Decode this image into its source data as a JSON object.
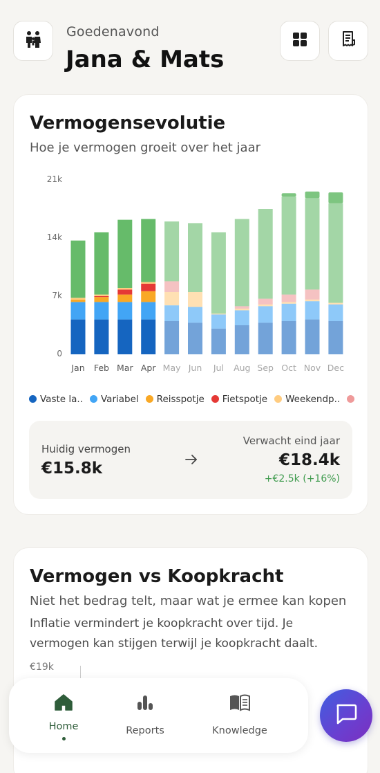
{
  "header": {
    "greeting": "Goedenavond",
    "names": "Jana & Mats",
    "family_icon": "family-icon",
    "grid_icon": "grid-icon",
    "receipt_icon": "receipt-icon"
  },
  "wealth_card": {
    "title": "Vermogensevolutie",
    "subtitle": "Hoe je vermogen groeit over het jaar",
    "legend": [
      {
        "label": "Vaste la..",
        "color": "#1565c0"
      },
      {
        "label": "Variabel",
        "color": "#42a5f5"
      },
      {
        "label": "Reisspotje",
        "color": "#f9a825"
      },
      {
        "label": "Fietspotje",
        "color": "#e53935"
      },
      {
        "label": "Weekendp..",
        "color": "#ffcc80"
      },
      {
        "label": "",
        "color": "#ef9a9a"
      }
    ],
    "summary": {
      "current_label": "Huidig vermogen",
      "current_value": "€15.8k",
      "expected_label": "Verwacht eind jaar",
      "expected_value": "€18.4k",
      "delta": "+€2.5k (+16%)"
    }
  },
  "chart_data": {
    "type": "bar",
    "stacked": true,
    "categories": [
      "Jan",
      "Feb",
      "Mar",
      "Apr",
      "May",
      "Jun",
      "Jul",
      "Aug",
      "Sep",
      "Oct",
      "Nov",
      "Dec"
    ],
    "y_ticks": [
      "0",
      "7k",
      "14k",
      "21k"
    ],
    "ylim": [
      0,
      21000
    ],
    "grid": false,
    "legend_position": "bottom",
    "actual_months": 4,
    "series": [
      {
        "name": "Vaste la..",
        "color": "#1565c0",
        "values": [
          4200,
          4200,
          4200,
          4200,
          4000,
          3800,
          3100,
          3500,
          3800,
          4000,
          4200,
          4000
        ]
      },
      {
        "name": "Variabel",
        "color": "#42a5f5",
        "values": [
          2100,
          2100,
          2100,
          2100,
          1900,
          1900,
          1700,
          1800,
          2000,
          2100,
          2200,
          2000
        ]
      },
      {
        "name": "Reisspotje",
        "color": "#f9a825",
        "values": [
          300,
          600,
          900,
          1300,
          0,
          0,
          0,
          0,
          0,
          0,
          0,
          0
        ]
      },
      {
        "name": "Fietspotje",
        "color": "#e53935",
        "values": [
          0,
          100,
          600,
          900,
          0,
          0,
          0,
          0,
          0,
          0,
          0,
          0
        ]
      },
      {
        "name": "Weekendp..",
        "color": "#ffcc80",
        "values": [
          200,
          200,
          200,
          200,
          1600,
          1800,
          100,
          200,
          200,
          200,
          200,
          200
        ]
      },
      {
        "name": "",
        "color": "#ef9a9a",
        "values": [
          0,
          0,
          0,
          0,
          1300,
          0,
          0,
          300,
          700,
          900,
          1200,
          0
        ]
      },
      {
        "name": "",
        "color": "#66bb6a",
        "values": [
          6900,
          7500,
          8200,
          7600,
          7200,
          8300,
          9800,
          10500,
          10800,
          11800,
          11000,
          12000
        ]
      }
    ],
    "totals_top_dark": [
      0,
      0,
      0,
      0,
      0,
      0,
      0,
      0,
      0,
      400,
      800,
      1300
    ]
  },
  "purchasing_card": {
    "title": "Vermogen vs Koopkracht",
    "subtitle": "Niet het bedrag telt, maar wat je ermee kan kopen",
    "body": "Inflatie vermindert je koopkracht over tijd. Je vermogen kan stijgen terwijl je koopkracht daalt.",
    "axis_label": "€19k"
  },
  "bottom_nav": {
    "items": [
      {
        "label": "Home",
        "icon": "home-icon",
        "active": true
      },
      {
        "label": "Reports",
        "icon": "reports-icon",
        "active": false
      },
      {
        "label": "Knowledge",
        "icon": "book-icon",
        "active": false
      }
    ],
    "chat_icon": "chat-icon"
  },
  "colors": {
    "accent_green": "#2f5d3a",
    "positive_delta": "#3f9b4e",
    "chat_gradient_start": "#3f5fe0",
    "chat_gradient_end": "#7b2fbf"
  }
}
